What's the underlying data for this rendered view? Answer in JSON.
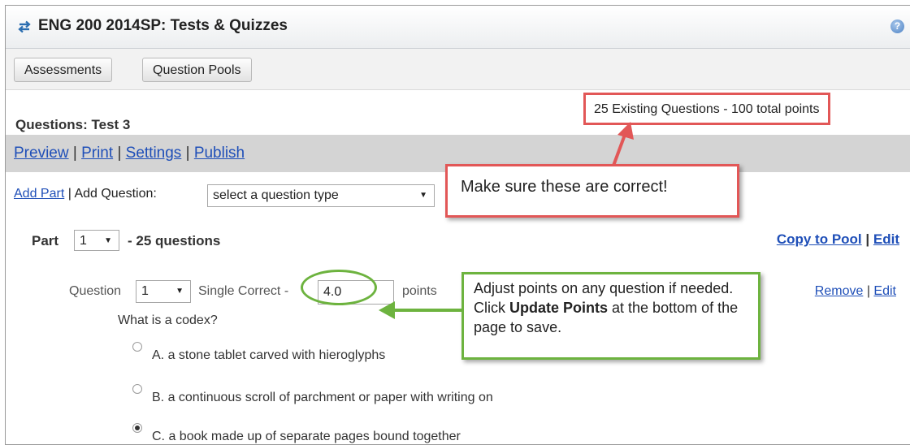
{
  "window": {
    "title": "ENG 200 2014SP: Tests & Quizzes",
    "help_icon": "?"
  },
  "toolbar": {
    "assessments_label": "Assessments",
    "question_pools_label": "Question Pools"
  },
  "page": {
    "section_title": "Questions: Test 3",
    "actions": {
      "preview": "Preview",
      "print": "Print",
      "settings": "Settings",
      "publish": "Publish",
      "separator": "|"
    },
    "add_part_label": "Add Part",
    "add_question_label": "| Add Question:",
    "question_type_select": "select a question type",
    "part": {
      "label": "Part",
      "number": "1",
      "count_text": "- 25 questions",
      "copy_to_pool": "Copy to Pool",
      "edit": "Edit",
      "separator": "|"
    },
    "question": {
      "label": "Question",
      "number": "1",
      "type_text": "Single Correct -",
      "points_value": "4.0",
      "points_label": "points",
      "remove": "Remove",
      "edit": "Edit",
      "separator": "|",
      "text": "What is a codex?",
      "choices": [
        {
          "text": "A. a stone tablet carved with hieroglyphs",
          "selected": false
        },
        {
          "text": "B. a continuous scroll of parchment or paper with writing on",
          "selected": false
        },
        {
          "text": "C. a book made up of separate pages bound together",
          "selected": true
        }
      ]
    }
  },
  "annotations": {
    "summary_box": "25 Existing Questions - 100 total points",
    "red_callout": "Make sure these are correct!",
    "green_callout_part1": "Adjust points on any question if needed. Click ",
    "green_callout_bold": "Update Points",
    "green_callout_part2": " at the bottom of the page to save.",
    "red_color": "#e25757",
    "green_color": "#6db33f"
  }
}
